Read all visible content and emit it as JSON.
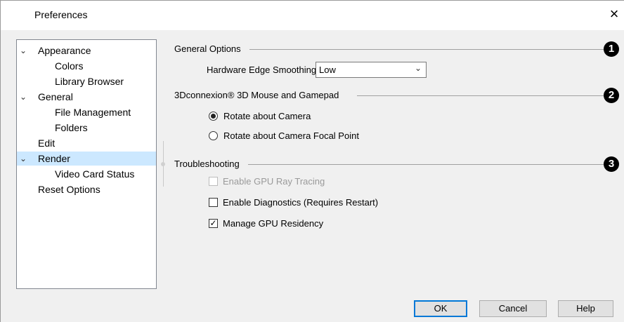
{
  "window": {
    "title": "Preferences",
    "close_symbol": "×"
  },
  "tree": {
    "items": [
      {
        "label": "Appearance",
        "expanded": true
      },
      {
        "label": "Colors"
      },
      {
        "label": "Library Browser"
      },
      {
        "label": "General",
        "expanded": true
      },
      {
        "label": "File Management"
      },
      {
        "label": "Folders"
      },
      {
        "label": "Edit"
      },
      {
        "label": "Render",
        "expanded": true,
        "selected": true
      },
      {
        "label": "Video Card Status"
      },
      {
        "label": "Reset Options"
      }
    ],
    "chevron": "⌄"
  },
  "general_options": {
    "heading": "General Options",
    "badge": "1",
    "edge_smoothing_label": "Hardware Edge Smoothing:",
    "edge_smoothing_value": "Low"
  },
  "mouse": {
    "heading": "3Dconnexion® 3D Mouse and Gamepad",
    "badge": "2",
    "rotate_camera": "Rotate about Camera",
    "rotate_focal": "Rotate about Camera Focal Point",
    "selected": "rotate_camera"
  },
  "troubleshooting": {
    "heading": "Troubleshooting",
    "badge": "3",
    "gpu_ray_tracing": {
      "label": "Enable GPU Ray Tracing",
      "checked": false,
      "disabled": true
    },
    "diagnostics": {
      "label": "Enable Diagnostics (Requires Restart)",
      "checked": false
    },
    "gpu_residency": {
      "label": "Manage GPU Residency",
      "checked": true
    }
  },
  "buttons": {
    "ok": "OK",
    "cancel": "Cancel",
    "help": "Help"
  },
  "colors": {
    "selection": "#cce8ff",
    "default_button_border": "#0078d7",
    "dialog_bg": "#f0f0f0"
  }
}
